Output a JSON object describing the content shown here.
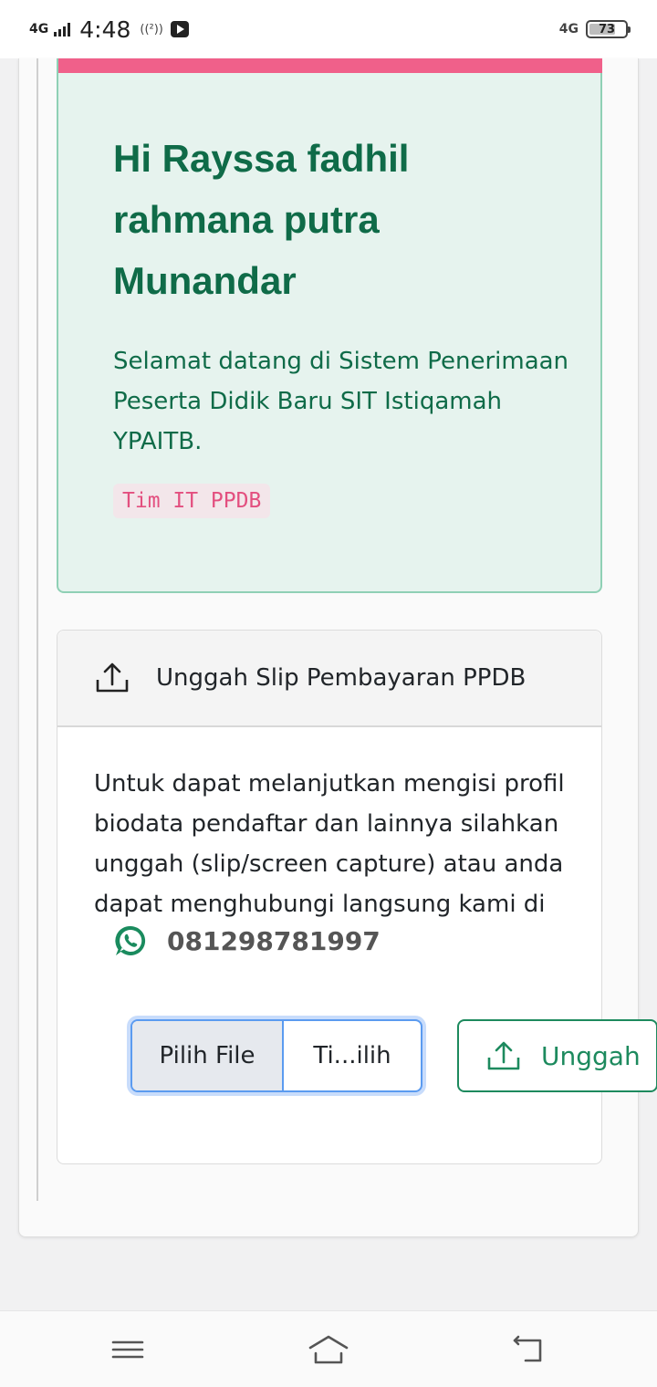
{
  "status_bar": {
    "network_left": "4G",
    "time": "4:48",
    "call_indicator": "((²))",
    "network_right": "4G",
    "battery_level": "73",
    "battery_fraction": 0.73
  },
  "welcome": {
    "greeting": "Hi Rayssa fadhil rahmana putra Munandar",
    "message": "Selamat datang di Sistem Penerimaan Peserta Didik Baru SIT Istiqamah YPAITB.",
    "signature": "Tim IT PPDB",
    "accent_color": "#f0608a",
    "text_color": "#0f6b48"
  },
  "upload": {
    "title": "Unggah Slip Pembayaran PPDB",
    "instructions": "Untuk dapat melanjutkan mengisi profil biodata pendaftar dan lainnya silahkan unggah (slip/screen capture) atau anda dapat menghubungi langsung kami di",
    "phone": "081298781997",
    "file_button_label": "Pilih File",
    "file_name_label": "Ti...ilih",
    "submit_label": "Unggah",
    "icons": {
      "header": "upload-icon",
      "contact": "whatsapp-icon",
      "submit": "upload-icon"
    },
    "submit_color": "#1d8a5e"
  },
  "nav": {
    "items": [
      "menu-icon",
      "home-icon",
      "back-icon"
    ]
  }
}
